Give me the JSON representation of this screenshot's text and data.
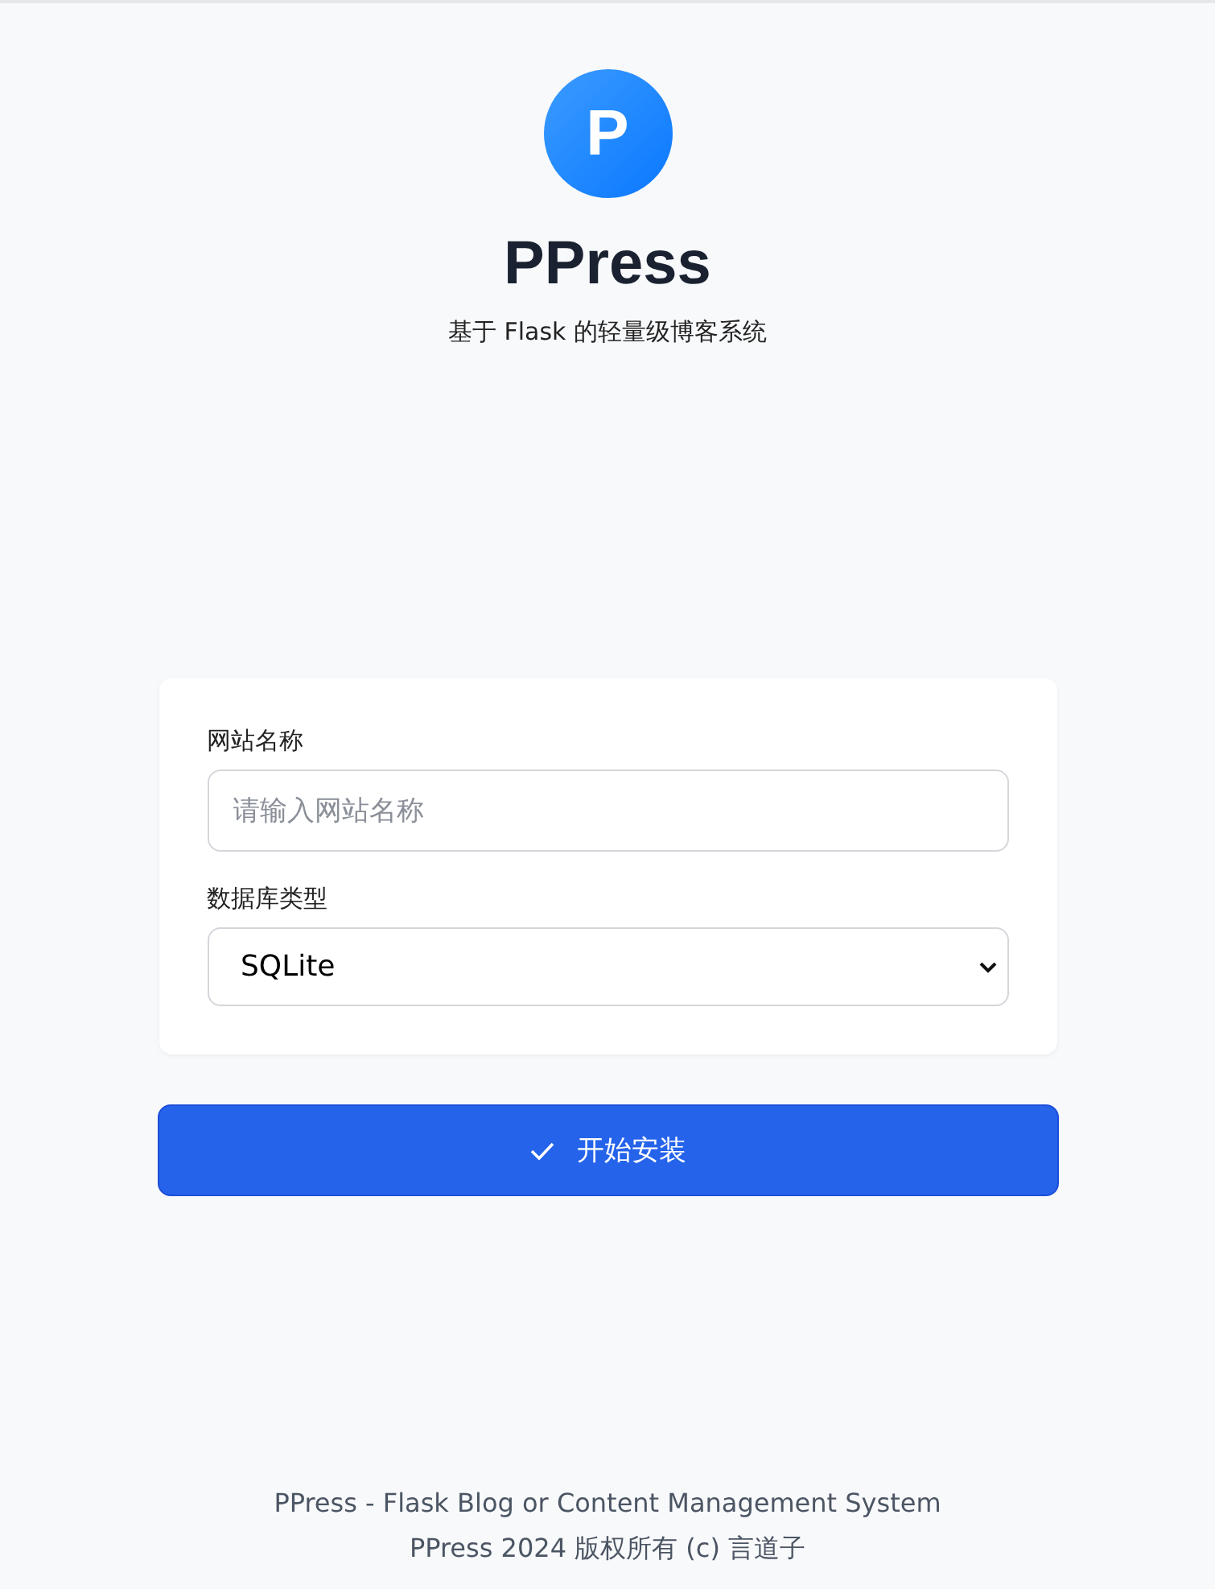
{
  "logo": {
    "letter": "P"
  },
  "title": "PPress",
  "subtitle": "基于 Flask 的轻量级博客系统",
  "form": {
    "fields": [
      {
        "kind": "text",
        "label": "网站名称",
        "placeholder": "请输入网站名称"
      },
      {
        "kind": "select",
        "label": "数据库类型",
        "value": "SQLite"
      }
    ]
  },
  "submit_button": "开始安装",
  "footer": [
    "PPress - Flask Blog or Content Management System",
    "PPress 2024 版权所有 (c) 言道子"
  ]
}
